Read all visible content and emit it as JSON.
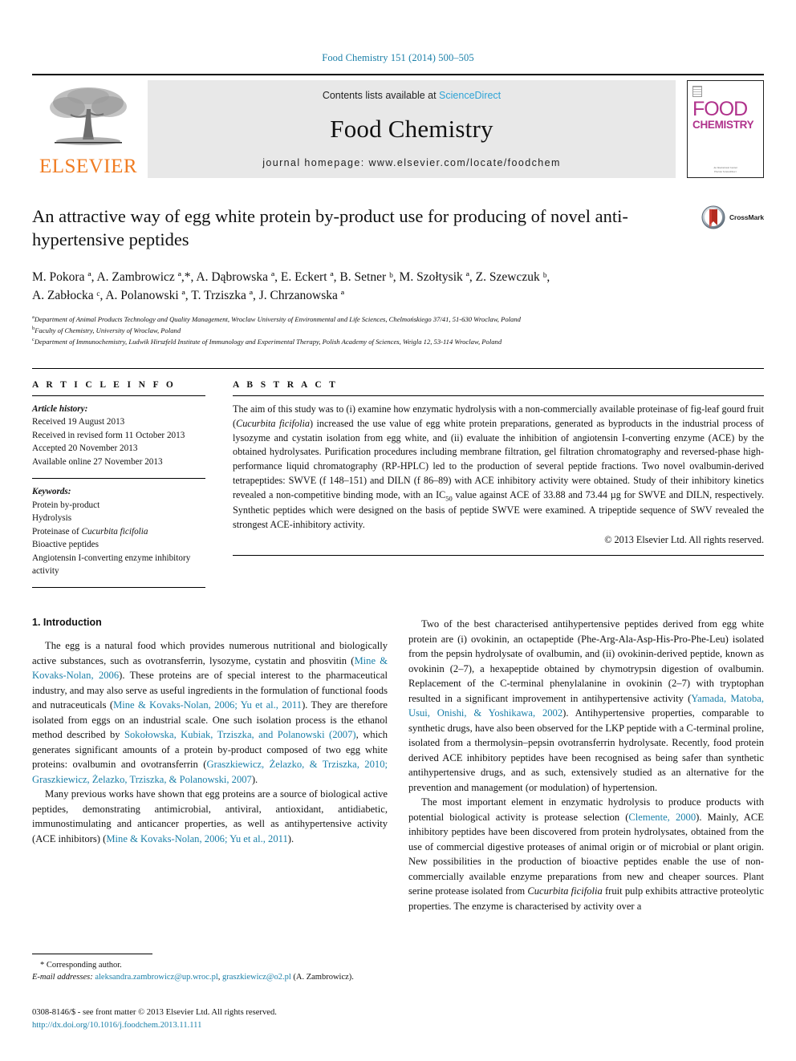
{
  "running_head": "Food Chemistry 151 (2014) 500–505",
  "masthead": {
    "publisher_name": "ELSEVIER",
    "contents_prefix": "Contents lists available at ",
    "contents_link": "ScienceDirect",
    "journal_name": "Food Chemistry",
    "homepage": "journal homepage: www.elsevier.com/locate/foodchem",
    "cover": {
      "title_top": "FOOD",
      "title_bottom": "CHEMISTRY",
      "footer_line1": "An International Journal",
      "footer_line2": "Elsevier ScienceDirect"
    }
  },
  "article": {
    "title": "An attractive way of egg white protein by-product use for producing of novel anti-hypertensive peptides",
    "crossmark_label": "CrossMark",
    "authors_line1": "M. Pokora ª, A. Zambrowicz ª,*, A. Dąbrowska ª, E. Eckert ª, B. Setner ᵇ, M. Szołtysik ª, Z. Szewczuk ᵇ,",
    "authors_line2": "A. Zabłocka ᶜ, A. Polanowski ª, T. Trziszka ª, J. Chrzanowska ª",
    "affiliations": [
      {
        "marker": "a",
        "text": "Department of Animal Products Technology and Quality Management, Wroclaw University of Environmental and Life Sciences, Chelmońskiego 37/41, 51-630 Wroclaw, Poland"
      },
      {
        "marker": "b",
        "text": "Faculty of Chemistry, University of Wroclaw, Poland"
      },
      {
        "marker": "c",
        "text": "Department of Immunochemistry, Ludwik Hirszfeld Institute of Immunology and Experimental Therapy, Polish Academy of Sciences, Weigla 12, 53-114 Wroclaw, Poland"
      }
    ]
  },
  "article_info": {
    "heading": "A R T I C L E  I N F O",
    "history_label": "Article history:",
    "history": [
      "Received 19 August 2013",
      "Received in revised form 11 October 2013",
      "Accepted 20 November 2013",
      "Available online 27 November 2013"
    ],
    "keywords_label": "Keywords:",
    "keywords": [
      "Protein by-product",
      "Hydrolysis",
      "Proteinase of Cucurbita ficifolia",
      "Bioactive peptides",
      "Angiotensin I-converting enzyme inhibitory activity"
    ]
  },
  "abstract": {
    "heading": "A B S T R A C T",
    "text": "The aim of this study was to (i) examine how enzymatic hydrolysis with a non-commercially available proteinase of fig-leaf gourd fruit (Cucurbita ficifolia) increased the use value of egg white protein preparations, generated as byproducts in the industrial process of lysozyme and cystatin isolation from egg white, and (ii) evaluate the inhibition of angiotensin I-converting enzyme (ACE) by the obtained hydrolysates. Purification procedures including membrane filtration, gel filtration chromatography and reversed-phase high-performance liquid chromatography (RP-HPLC) led to the production of several peptide fractions. Two novel ovalbumin-derived tetrapeptides: SWVE (f 148–151) and DILN (f 86–89) with ACE inhibitory activity were obtained. Study of their inhibitory kinetics revealed a non-competitive binding mode, with an IC50 value against ACE of 33.88 and 73.44 µg for SWVE and DILN, respectively. Synthetic peptides which were designed on the basis of peptide SWVE were examined. A tripeptide sequence of SWV revealed the strongest ACE-inhibitory activity.",
    "copyright": "© 2013 Elsevier Ltd. All rights reserved."
  },
  "body": {
    "section_heading": "1. Introduction",
    "left_paragraphs": [
      "The egg is a natural food which provides numerous nutritional and biologically active substances, such as ovotransferrin, lysozyme, cystatin and phosvitin (Mine & Kovaks-Nolan, 2006). These proteins are of special interest to the pharmaceutical industry, and may also serve as useful ingredients in the formulation of functional foods and nutraceuticals (Mine & Kovaks-Nolan, 2006; Yu et al., 2011). They are therefore isolated from eggs on an industrial scale. One such isolation process is the ethanol method described by Sokołowska, Kubiak, Trziszka, and Polanowski (2007), which generates significant amounts of a protein by-product composed of two egg white proteins: ovalbumin and ovotransferrin (Graszkiewicz, Żelazko, & Trziszka, 2010; Graszkiewicz, Żelazko, Trziszka, & Polanowski, 2007).",
      "Many previous works have shown that egg proteins are a source of biological active peptides, demonstrating antimicrobial, antiviral, antioxidant, antidiabetic, immunostimulating and anticancer properties, as well as antihypertensive activity (ACE inhibitors) (Mine & Kovaks-Nolan, 2006; Yu et al., 2011)."
    ],
    "right_paragraphs": [
      "Two of the best characterised antihypertensive peptides derived from egg white protein are (i) ovokinin, an octapeptide (Phe-Arg-Ala-Asp-His-Pro-Phe-Leu) isolated from the pepsin hydrolysate of ovalbumin, and (ii) ovokinin-derived peptide, known as ovokinin (2–7), a hexapeptide obtained by chymotrypsin digestion of ovalbumin. Replacement of the C-terminal phenylalanine in ovokinin (2–7) with tryptophan resulted in a significant improvement in antihypertensive activity (Yamada, Matoba, Usui, Onishi, & Yoshikawa, 2002). Antihypertensive properties, comparable to synthetic drugs, have also been observed for the LKP peptide with a C-terminal proline, isolated from a thermolysin–pepsin ovotransferrin hydrolysate. Recently, food protein derived ACE inhibitory peptides have been recognised as being safer than synthetic antihypertensive drugs, and as such, extensively studied as an alternative for the prevention and management (or modulation) of hypertension.",
      "The most important element in enzymatic hydrolysis to produce products with potential biological activity is protease selection (Clemente, 2000). Mainly, ACE inhibitory peptides have been discovered from protein hydrolysates, obtained from the use of commercial digestive proteases of animal origin or of microbial or plant origin. New possibilities in the production of bioactive peptides enable the use of non-commercially available enzyme preparations from new and cheaper sources. Plant serine protease isolated from Cucurbita ficifolia fruit pulp exhibits attractive proteolytic properties. The enzyme is characterised by activity over a"
    ]
  },
  "footnote": {
    "corresponding": "* Corresponding author.",
    "email_label": "E-mail addresses:",
    "email1": "aleksandra.zambrowicz@up.wroc.pl",
    "email2": "graszkiewicz@o2.pl",
    "email_owner": "(A. Zambrowicz)."
  },
  "imprint": {
    "line1": "0308-8146/$ - see front matter © 2013 Elsevier Ltd. All rights reserved.",
    "doi": "http://dx.doi.org/10.1016/j.foodchem.2013.11.111"
  },
  "colors": {
    "link": "#1a7fa8",
    "sciencedirect": "#2da3d6",
    "elsevier_orange": "#F07C22",
    "cover_magenta": "#b0338c",
    "band_grey": "#e8e8e8"
  }
}
